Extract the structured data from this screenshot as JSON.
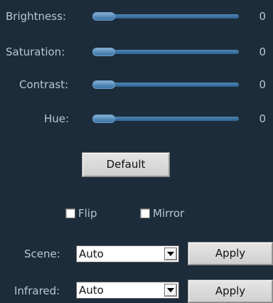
{
  "sliders": [
    {
      "id": "brightness",
      "label": "Brightness:",
      "value": "0",
      "level": 0
    },
    {
      "id": "saturation",
      "label": "Saturation:",
      "value": "0",
      "level": 0
    },
    {
      "id": "contrast",
      "label": "Contrast:",
      "value": "0",
      "level": 0
    },
    {
      "id": "hue",
      "label": "Hue:",
      "value": "0",
      "level": 0
    }
  ],
  "default_button": "Default",
  "flip": {
    "label": "Flip",
    "checked": false
  },
  "mirror": {
    "label": "Mirror",
    "checked": false
  },
  "scene": {
    "label": "Scene:",
    "value": "Auto",
    "apply": "Apply"
  },
  "infrared": {
    "label": "Infrared:",
    "value": "Auto",
    "apply": "Apply"
  },
  "colors": {
    "background": "#1c2c3a",
    "text": "#b9c7d4",
    "slider": "#3b70a0"
  }
}
